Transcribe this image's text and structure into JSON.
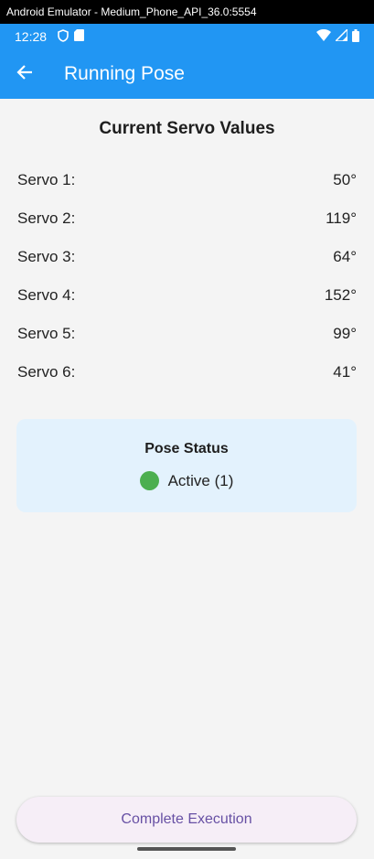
{
  "window": {
    "title": "Android Emulator - Medium_Phone_API_36.0:5554"
  },
  "status_bar": {
    "time": "12:28",
    "icons": [
      "shield-icon",
      "sd-card-icon",
      "wifi-icon",
      "signal-icon",
      "battery-icon"
    ]
  },
  "app_bar": {
    "title": "Running Pose",
    "back_icon": "arrow-back-icon"
  },
  "servos": {
    "title": "Current Servo Values",
    "items": [
      {
        "label": "Servo 1:",
        "value": "50°"
      },
      {
        "label": "Servo 2:",
        "value": "119°"
      },
      {
        "label": "Servo 3:",
        "value": "64°"
      },
      {
        "label": "Servo 4:",
        "value": "152°"
      },
      {
        "label": "Servo 5:",
        "value": "99°"
      },
      {
        "label": "Servo 6:",
        "value": "41°"
      }
    ]
  },
  "pose_status": {
    "title": "Pose Status",
    "status_text": "Active (1)",
    "status_color": "#4caf50"
  },
  "actions": {
    "complete_label": "Complete Execution"
  },
  "theme": {
    "primary": "#2196f3",
    "card_bg": "#e3f2fd",
    "button_text": "#6750a4"
  }
}
